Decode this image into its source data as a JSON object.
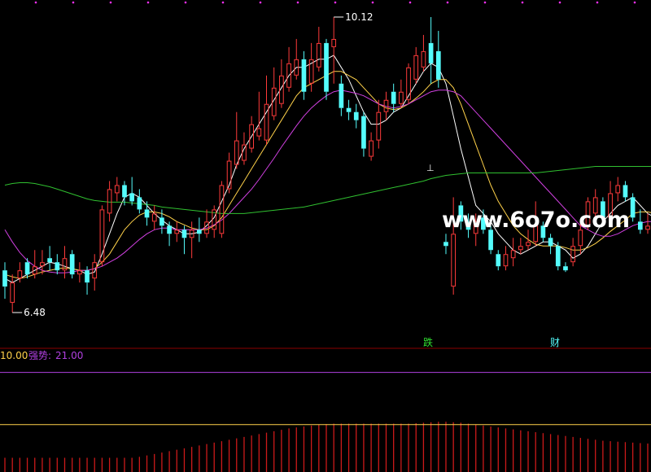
{
  "chart_data": {
    "type": "candlestick",
    "price_panel": {
      "ylim": [
        6.2,
        10.25
      ],
      "high_label": "10.12",
      "low_label": "6.48",
      "watermark": "www.6o7o.com",
      "annotations": [
        "跌",
        "财",
        "⊥"
      ],
      "candles": [
        {
          "o": 7.0,
          "c": 6.8,
          "h": 7.1,
          "l": 6.65
        },
        {
          "o": 6.6,
          "c": 6.85,
          "h": 6.95,
          "l": 6.48
        },
        {
          "o": 6.9,
          "c": 7.0,
          "h": 7.1,
          "l": 6.85
        },
        {
          "o": 7.1,
          "c": 6.95,
          "h": 7.15,
          "l": 6.9
        },
        {
          "o": 6.95,
          "c": 7.05,
          "h": 7.25,
          "l": 6.9
        },
        {
          "o": 7.05,
          "c": 7.1,
          "h": 7.25,
          "l": 6.95
        },
        {
          "o": 7.15,
          "c": 7.1,
          "h": 7.3,
          "l": 7.0
        },
        {
          "o": 7.1,
          "c": 7.0,
          "h": 7.2,
          "l": 6.95
        },
        {
          "o": 7.0,
          "c": 7.15,
          "h": 7.3,
          "l": 6.9
        },
        {
          "o": 7.2,
          "c": 6.95,
          "h": 7.25,
          "l": 6.9
        },
        {
          "o": 6.95,
          "c": 7.0,
          "h": 7.1,
          "l": 6.85
        },
        {
          "o": 7.0,
          "c": 6.85,
          "h": 7.05,
          "l": 6.7
        },
        {
          "o": 6.9,
          "c": 7.1,
          "h": 7.2,
          "l": 6.75
        },
        {
          "o": 7.1,
          "c": 7.75,
          "h": 7.8,
          "l": 7.05
        },
        {
          "o": 7.7,
          "c": 8.0,
          "h": 8.1,
          "l": 7.6
        },
        {
          "o": 7.95,
          "c": 8.05,
          "h": 8.15,
          "l": 7.85
        },
        {
          "o": 8.05,
          "c": 7.9,
          "h": 8.1,
          "l": 7.8
        },
        {
          "o": 7.95,
          "c": 7.85,
          "h": 8.15,
          "l": 7.8
        },
        {
          "o": 7.9,
          "c": 7.75,
          "h": 8.0,
          "l": 7.7
        },
        {
          "o": 7.75,
          "c": 7.65,
          "h": 7.85,
          "l": 7.55
        },
        {
          "o": 7.6,
          "c": 7.7,
          "h": 7.8,
          "l": 7.5
        },
        {
          "o": 7.65,
          "c": 7.55,
          "h": 7.75,
          "l": 7.45
        },
        {
          "o": 7.55,
          "c": 7.45,
          "h": 7.6,
          "l": 7.3
        },
        {
          "o": 7.45,
          "c": 7.5,
          "h": 7.6,
          "l": 7.35
        },
        {
          "o": 7.5,
          "c": 7.4,
          "h": 7.55,
          "l": 7.2
        },
        {
          "o": 7.4,
          "c": 7.5,
          "h": 7.6,
          "l": 7.15
        },
        {
          "o": 7.5,
          "c": 7.45,
          "h": 7.65,
          "l": 7.35
        },
        {
          "o": 7.45,
          "c": 7.6,
          "h": 7.75,
          "l": 7.4
        },
        {
          "o": 7.5,
          "c": 7.75,
          "h": 7.8,
          "l": 7.4
        },
        {
          "o": 7.45,
          "c": 8.05,
          "h": 8.1,
          "l": 7.4
        },
        {
          "o": 8.0,
          "c": 8.35,
          "h": 8.45,
          "l": 7.95
        },
        {
          "o": 8.3,
          "c": 8.6,
          "h": 8.95,
          "l": 8.25
        },
        {
          "o": 8.35,
          "c": 8.55,
          "h": 8.7,
          "l": 8.3
        },
        {
          "o": 8.5,
          "c": 8.8,
          "h": 8.9,
          "l": 8.45
        },
        {
          "o": 8.65,
          "c": 8.75,
          "h": 9.2,
          "l": 8.6
        },
        {
          "o": 8.6,
          "c": 9.05,
          "h": 9.4,
          "l": 8.55
        },
        {
          "o": 8.9,
          "c": 9.25,
          "h": 9.5,
          "l": 8.85
        },
        {
          "o": 9.05,
          "c": 9.4,
          "h": 9.6,
          "l": 9.0
        },
        {
          "o": 9.25,
          "c": 9.55,
          "h": 9.75,
          "l": 9.2
        },
        {
          "o": 9.4,
          "c": 9.6,
          "h": 9.85,
          "l": 9.35
        },
        {
          "o": 9.6,
          "c": 9.2,
          "h": 9.7,
          "l": 9.1
        },
        {
          "o": 9.3,
          "c": 9.6,
          "h": 9.8,
          "l": 9.2
        },
        {
          "o": 9.5,
          "c": 9.8,
          "h": 10.0,
          "l": 9.45
        },
        {
          "o": 9.8,
          "c": 9.2,
          "h": 9.85,
          "l": 9.1
        },
        {
          "o": 9.75,
          "c": 9.85,
          "h": 10.12,
          "l": 9.3
        },
        {
          "o": 9.3,
          "c": 9.0,
          "h": 9.4,
          "l": 8.9
        },
        {
          "o": 9.0,
          "c": 8.95,
          "h": 9.1,
          "l": 8.85
        },
        {
          "o": 8.95,
          "c": 8.85,
          "h": 9.05,
          "l": 8.75
        },
        {
          "o": 8.9,
          "c": 8.5,
          "h": 8.95,
          "l": 8.4
        },
        {
          "o": 8.4,
          "c": 8.6,
          "h": 8.7,
          "l": 8.35
        },
        {
          "o": 8.6,
          "c": 8.95,
          "h": 9.1,
          "l": 8.5
        },
        {
          "o": 8.95,
          "c": 9.1,
          "h": 9.2,
          "l": 8.85
        },
        {
          "o": 9.2,
          "c": 9.05,
          "h": 9.3,
          "l": 8.95
        },
        {
          "o": 9.05,
          "c": 9.2,
          "h": 9.35,
          "l": 9.0
        },
        {
          "o": 9.1,
          "c": 9.5,
          "h": 9.55,
          "l": 9.05
        },
        {
          "o": 9.35,
          "c": 9.65,
          "h": 9.75,
          "l": 9.3
        },
        {
          "o": 9.5,
          "c": 9.7,
          "h": 9.9,
          "l": 9.45
        },
        {
          "o": 9.8,
          "c": 9.55,
          "h": 10.12,
          "l": 9.3
        },
        {
          "o": 9.7,
          "c": 9.35,
          "h": 9.95,
          "l": 9.25
        },
        {
          "o": 7.35,
          "c": 7.3,
          "h": 7.45,
          "l": 7.2
        },
        {
          "o": 6.8,
          "c": 7.45,
          "h": 7.9,
          "l": 6.7
        },
        {
          "o": 7.8,
          "c": 7.6,
          "h": 7.85,
          "l": 7.5
        },
        {
          "o": 7.6,
          "c": 7.5,
          "h": 7.7,
          "l": 7.4
        },
        {
          "o": 7.45,
          "c": 7.6,
          "h": 7.7,
          "l": 7.3
        },
        {
          "o": 7.65,
          "c": 7.5,
          "h": 7.75,
          "l": 7.45
        },
        {
          "o": 7.5,
          "c": 7.25,
          "h": 7.55,
          "l": 7.2
        },
        {
          "o": 7.2,
          "c": 7.05,
          "h": 7.25,
          "l": 7.0
        },
        {
          "o": 7.05,
          "c": 7.2,
          "h": 7.3,
          "l": 7.0
        },
        {
          "o": 7.15,
          "c": 7.25,
          "h": 7.4,
          "l": 7.05
        },
        {
          "o": 7.25,
          "c": 7.3,
          "h": 7.4,
          "l": 7.2
        },
        {
          "o": 7.3,
          "c": 7.35,
          "h": 7.5,
          "l": 7.25
        },
        {
          "o": 7.35,
          "c": 7.55,
          "h": 7.85,
          "l": 7.3
        },
        {
          "o": 7.55,
          "c": 7.4,
          "h": 7.6,
          "l": 7.35
        },
        {
          "o": 7.4,
          "c": 7.3,
          "h": 7.45,
          "l": 7.2
        },
        {
          "o": 7.3,
          "c": 7.05,
          "h": 7.35,
          "l": 7.0
        },
        {
          "o": 7.05,
          "c": 7.0,
          "h": 7.1,
          "l": 6.98
        },
        {
          "o": 7.1,
          "c": 7.3,
          "h": 7.4,
          "l": 7.05
        },
        {
          "o": 7.3,
          "c": 7.5,
          "h": 7.6,
          "l": 7.2
        },
        {
          "o": 7.55,
          "c": 7.85,
          "h": 7.9,
          "l": 7.5
        },
        {
          "o": 7.7,
          "c": 7.9,
          "h": 8.0,
          "l": 7.6
        },
        {
          "o": 7.85,
          "c": 7.65,
          "h": 7.9,
          "l": 7.6
        },
        {
          "o": 7.65,
          "c": 7.95,
          "h": 8.1,
          "l": 7.6
        },
        {
          "o": 7.95,
          "c": 8.05,
          "h": 8.15,
          "l": 7.85
        },
        {
          "o": 8.05,
          "c": 7.9,
          "h": 8.1,
          "l": 7.85
        },
        {
          "o": 7.9,
          "c": 7.65,
          "h": 7.95,
          "l": 7.6
        },
        {
          "o": 7.6,
          "c": 7.5,
          "h": 7.75,
          "l": 7.45
        },
        {
          "o": 7.5,
          "c": 7.55,
          "h": 7.7,
          "l": 7.45
        }
      ],
      "ma_lines": [
        {
          "name": "MA5",
          "color": "#ffffff",
          "values": [
            6.9,
            6.85,
            6.9,
            6.95,
            7.0,
            7.05,
            7.1,
            7.08,
            7.05,
            7.02,
            7.0,
            6.95,
            6.98,
            7.2,
            7.45,
            7.7,
            7.9,
            7.95,
            7.9,
            7.8,
            7.7,
            7.62,
            7.55,
            7.5,
            7.45,
            7.45,
            7.47,
            7.55,
            7.65,
            7.85,
            8.05,
            8.3,
            8.5,
            8.65,
            8.8,
            8.95,
            9.1,
            9.25,
            9.4,
            9.5,
            9.5,
            9.55,
            9.6,
            9.6,
            9.65,
            9.5,
            9.35,
            9.15,
            8.95,
            8.8,
            8.8,
            8.85,
            8.95,
            9.0,
            9.15,
            9.3,
            9.45,
            9.55,
            9.5,
            9.3,
            8.9,
            8.5,
            8.15,
            7.8,
            7.7,
            7.6,
            7.45,
            7.35,
            7.25,
            7.2,
            7.25,
            7.3,
            7.35,
            7.35,
            7.3,
            7.25,
            7.15,
            7.2,
            7.3,
            7.45,
            7.6,
            7.7,
            7.8,
            7.85,
            7.9,
            7.8,
            7.7,
            7.65
          ]
        },
        {
          "name": "MA10",
          "color": "#ffd24a",
          "values": [
            6.95,
            6.92,
            6.9,
            6.92,
            6.95,
            6.98,
            7.0,
            7.02,
            7.03,
            7.02,
            7.0,
            7.0,
            7.02,
            7.1,
            7.2,
            7.35,
            7.5,
            7.6,
            7.68,
            7.72,
            7.72,
            7.7,
            7.66,
            7.6,
            7.56,
            7.52,
            7.5,
            7.5,
            7.55,
            7.65,
            7.8,
            7.95,
            8.1,
            8.25,
            8.4,
            8.55,
            8.7,
            8.85,
            9.0,
            9.15,
            9.25,
            9.3,
            9.35,
            9.4,
            9.45,
            9.45,
            9.4,
            9.35,
            9.25,
            9.15,
            9.05,
            9.0,
            8.98,
            9.0,
            9.05,
            9.12,
            9.2,
            9.3,
            9.35,
            9.35,
            9.25,
            9.05,
            8.8,
            8.55,
            8.3,
            8.05,
            7.85,
            7.7,
            7.55,
            7.45,
            7.38,
            7.32,
            7.3,
            7.3,
            7.3,
            7.28,
            7.25,
            7.25,
            7.28,
            7.33,
            7.4,
            7.48,
            7.55,
            7.62,
            7.7,
            7.72,
            7.72,
            7.7
          ]
        },
        {
          "name": "MA20",
          "color": "#d040e0",
          "values": [
            7.5,
            7.35,
            7.22,
            7.12,
            7.05,
            7.0,
            6.98,
            6.97,
            6.97,
            6.98,
            7.0,
            7.0,
            7.02,
            7.05,
            7.1,
            7.15,
            7.22,
            7.3,
            7.38,
            7.45,
            7.5,
            7.52,
            7.52,
            7.5,
            7.5,
            7.5,
            7.5,
            7.52,
            7.56,
            7.62,
            7.7,
            7.8,
            7.9,
            8.0,
            8.12,
            8.25,
            8.38,
            8.52,
            8.65,
            8.78,
            8.9,
            9.0,
            9.08,
            9.15,
            9.2,
            9.22,
            9.2,
            9.18,
            9.15,
            9.1,
            9.05,
            9.02,
            9.0,
            9.02,
            9.05,
            9.1,
            9.15,
            9.2,
            9.22,
            9.22,
            9.2,
            9.15,
            9.05,
            8.95,
            8.85,
            8.75,
            8.65,
            8.55,
            8.45,
            8.35,
            8.25,
            8.15,
            8.05,
            7.95,
            7.85,
            7.75,
            7.65,
            7.55,
            7.5,
            7.45,
            7.42,
            7.42,
            7.45,
            7.5,
            7.55,
            7.58,
            7.6,
            7.6
          ]
        },
        {
          "name": "MA60",
          "color": "#30c030",
          "values": [
            8.05,
            8.07,
            8.08,
            8.08,
            8.07,
            8.05,
            8.03,
            8.0,
            7.97,
            7.94,
            7.91,
            7.88,
            7.86,
            7.85,
            7.84,
            7.84,
            7.84,
            7.83,
            7.82,
            7.81,
            7.8,
            7.78,
            7.77,
            7.76,
            7.75,
            7.74,
            7.73,
            7.72,
            7.71,
            7.7,
            7.7,
            7.7,
            7.7,
            7.71,
            7.72,
            7.73,
            7.74,
            7.75,
            7.76,
            7.77,
            7.78,
            7.8,
            7.82,
            7.84,
            7.86,
            7.88,
            7.9,
            7.92,
            7.94,
            7.96,
            7.98,
            8.0,
            8.02,
            8.04,
            8.06,
            8.08,
            8.1,
            8.13,
            8.15,
            8.17,
            8.18,
            8.19,
            8.2,
            8.2,
            8.2,
            8.2,
            8.2,
            8.2,
            8.2,
            8.2,
            8.2,
            8.2,
            8.21,
            8.22,
            8.23,
            8.24,
            8.25,
            8.26,
            8.27,
            8.28,
            8.28,
            8.28,
            8.28,
            8.28,
            8.28,
            8.28,
            8.28,
            8.28
          ]
        }
      ]
    },
    "indicator_panel": {
      "label_left": "10.00",
      "label_name": "强势:",
      "label_value": "21.00",
      "strength_line": 21.0,
      "base_line": 10.0,
      "ylim": [
        0,
        23
      ],
      "bars": [
        3,
        3,
        3,
        3,
        3,
        3,
        3,
        3,
        3,
        3,
        3,
        3,
        3,
        3,
        3,
        3,
        3,
        3,
        3.2,
        3.5,
        3.8,
        4.1,
        4.4,
        4.7,
        5.0,
        5.3,
        5.6,
        5.9,
        6.2,
        6.5,
        6.8,
        7.1,
        7.4,
        7.7,
        8.0,
        8.3,
        8.6,
        8.9,
        9.2,
        9.4,
        9.6,
        9.8,
        10.0,
        10.1,
        10.2,
        10.2,
        10.2,
        10.2,
        10.2,
        10.2,
        10.2,
        10.2,
        10.2,
        10.2,
        10.2,
        10.3,
        10.4,
        10.5,
        10.6,
        10.6,
        10.5,
        10.4,
        10.2,
        10.0,
        9.8,
        9.6,
        9.4,
        9.2,
        9.0,
        8.8,
        8.6,
        8.4,
        8.2,
        8.0,
        7.8,
        7.6,
        7.4,
        7.2,
        7.0,
        6.8,
        6.6,
        6.5,
        6.4,
        6.3,
        6.2,
        6.1,
        6.0,
        5.9
      ]
    },
    "colors": {
      "up": "#ff3b3b",
      "down": "#54fcfc",
      "background": "#000000",
      "grid": "#8b0000",
      "strength_line": "#b040e0",
      "base_line": "#ffd24a",
      "bar": "#cc1a1a",
      "label_left": "#ffd24a",
      "label_name": "#b040e0",
      "annot_down": "#30e030",
      "annot_finance": "#54fcfc"
    }
  }
}
